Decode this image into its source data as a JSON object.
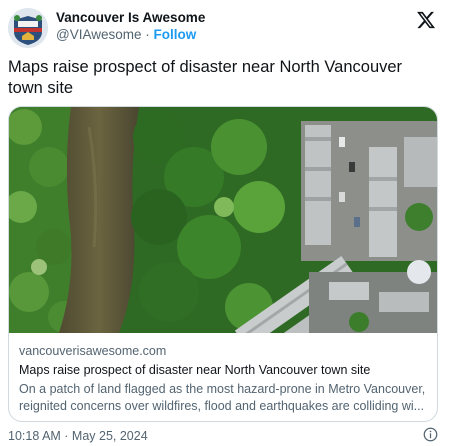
{
  "author": {
    "display_name": "Vancouver Is Awesome",
    "handle": "@VIAwesome",
    "separator": "·",
    "follow_label": "Follow"
  },
  "tweet": {
    "text": "Maps raise prospect of disaster near North Vancouver town site"
  },
  "card": {
    "domain": "vancouverisawesome.com",
    "title": "Maps raise prospect of disaster near North Vancouver town site",
    "description": "On a patch of land flagged as the most hazard-prone in Metro Vancouver, reignited concerns over wildfires, flood and earthquakes are colliding wi..."
  },
  "timestamp": "10:18 AM · May 25, 2024",
  "icons": {
    "brand": "x-logo-icon",
    "info": "info-icon",
    "avatar": "avatar-icon"
  },
  "colors": {
    "text": "#0f1419",
    "secondary": "#536471",
    "link": "#1d9bf0",
    "border": "#cfd9de"
  }
}
